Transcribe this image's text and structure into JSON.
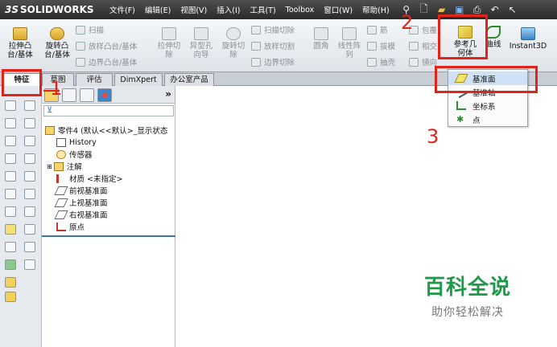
{
  "app": {
    "logo_prefix": "3S",
    "logo_text": "SOLIDWORKS"
  },
  "menu": [
    "文件(F)",
    "编辑(E)",
    "视图(V)",
    "插入(I)",
    "工具(T)",
    "Toolbox",
    "窗口(W)",
    "帮助(H)"
  ],
  "ribbon": {
    "extrude_boss": "拉伸凸\n台/基体",
    "revolve_boss": "旋转凸\n台/基体",
    "sweep": "扫描",
    "loft_boss": "放样凸台/基体",
    "boundary_boss": "边界凸台/基体",
    "extrude_cut": "拉伸切\n除",
    "hole_wizard": "异型孔\n向导",
    "revolve_cut": "旋转切\n除",
    "swept_cut": "扫描切除",
    "lofted_cut": "放样切割",
    "boundary_cut": "边界切除",
    "fillet": "圆角",
    "linear_pattern": "线性阵\n列",
    "rib": "筋",
    "draft": "拔模",
    "shell": "抽壳",
    "wrap": "包覆",
    "intersect": "相交",
    "mirror": "镜向",
    "ref_geometry": "参考几\n何体",
    "curves": "曲线",
    "instant3d": "Instant3D"
  },
  "tabs": [
    "特征",
    "草图",
    "评估",
    "DimXpert",
    "办公室产品"
  ],
  "tree": {
    "part": "零件4 (默认<<默认>_显示状态",
    "history": "History",
    "sensors": "传感器",
    "annotations": "注解",
    "material": "材质 <未指定>",
    "front_plane": "前视基准面",
    "top_plane": "上视基准面",
    "right_plane": "右视基准面",
    "origin": "原点"
  },
  "dropdown": {
    "items": [
      "基准面",
      "基准轴",
      "坐标系",
      "点"
    ]
  },
  "annotations": {
    "step1": "1",
    "step2": "2",
    "step3": "3"
  },
  "watermark": {
    "title": "百科全说",
    "subtitle": "助你轻松解决"
  },
  "colors": {
    "highlight_red": "#e2231a",
    "watermark_green": "#1c9a4a"
  }
}
